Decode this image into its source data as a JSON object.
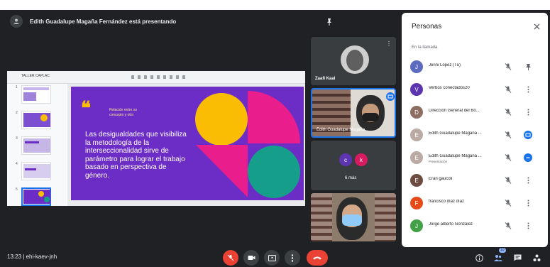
{
  "presenter_banner": "Edith Guadalupe Magaña Fernández está presentando",
  "slides_doc_title": "TALLER CAPLAC",
  "slide": {
    "label": "Relación entre su concepto y otro",
    "quote_mark": "❝",
    "text": "Las desigualdades que visibiliza la metodología de la interseccionalidad sirve de parámetro para lograr el trabajo basado en perspectiva de género."
  },
  "thumb_numbers": [
    "1",
    "2",
    "3",
    "4",
    "5"
  ],
  "tiles": {
    "first_name": "Zaafi Kaal",
    "second_name": "Edith Guadalupe Magaña",
    "others_label": "6 más",
    "others_avatars": [
      "c",
      "k"
    ]
  },
  "bottom": {
    "clock": "13:23",
    "meeting_code": "ehi-kaev-jnh",
    "people_count": "10"
  },
  "panel": {
    "title": "Personas",
    "section": "En la llamada",
    "participants": [
      {
        "name": "Jenni López (Tú)",
        "initial": "J",
        "color": "#5c6bc0",
        "sub": "",
        "action": "pin-icon"
      },
      {
        "name": "Verbos conectados20",
        "initial": "V",
        "color": "#5e35b1",
        "sub": "",
        "action": "more-vert-icon"
      },
      {
        "name": "Dirección General del Bo...",
        "initial": "D",
        "color": "#8d6e63",
        "sub": "",
        "action": "more-vert-icon"
      },
      {
        "name": "Edith Guadalupe Magaña ...",
        "initial": "E",
        "color": "#bcaaa4",
        "sub": "",
        "action": "presenting-icon"
      },
      {
        "name": "Edith Guadalupe Magaña ...",
        "initial": "E",
        "color": "#bcaaa4",
        "sub": "Presentación",
        "action": "remove-icon"
      },
      {
        "name": "Eran gaucoli",
        "initial": "E",
        "color": "#6d4c41",
        "sub": "",
        "action": "more-vert-icon"
      },
      {
        "name": "francisco díaz díaz",
        "initial": "F",
        "color": "#e64a19",
        "sub": "",
        "action": "more-vert-icon"
      },
      {
        "name": "Jorge alberto González",
        "initial": "J",
        "color": "#43a047",
        "sub": "",
        "action": "more-vert-icon"
      }
    ]
  },
  "colors": {
    "meet_bg": "#202124",
    "slide_purple": "#6c2dc7",
    "accent_yellow": "#fbbc04",
    "accent_magenta": "#e91e8c",
    "accent_teal": "#159e8a",
    "leave_red": "#ea4335"
  }
}
